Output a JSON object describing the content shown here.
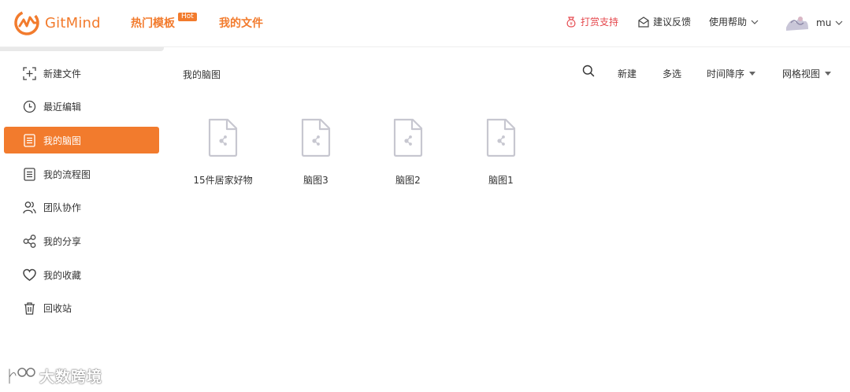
{
  "app": {
    "name": "GitMind",
    "brand_color": "#f27b2d"
  },
  "header": {
    "templates_label": "热门模板",
    "hot_badge": "Hot",
    "files_label": "我的文件",
    "reward_label": "打赏支持",
    "feedback_label": "建议反馈",
    "help_label": "使用帮助",
    "user_name": "mu"
  },
  "sidebar": {
    "items": [
      {
        "label": "新建文件",
        "icon": "new-file-icon"
      },
      {
        "label": "最近编辑",
        "icon": "clock-icon"
      },
      {
        "label": "我的脑图",
        "icon": "document-icon",
        "active": true
      },
      {
        "label": "我的流程图",
        "icon": "document-icon"
      },
      {
        "label": "团队协作",
        "icon": "team-icon"
      },
      {
        "label": "我的分享",
        "icon": "share-icon"
      },
      {
        "label": "我的收藏",
        "icon": "heart-icon"
      },
      {
        "label": "回收站",
        "icon": "trash-icon"
      }
    ]
  },
  "main": {
    "breadcrumb": "我的脑图",
    "toolbar": {
      "new_label": "新建",
      "multi_select_label": "多选",
      "sort_label": "时间降序",
      "view_label": "网格视图"
    },
    "files": [
      {
        "name": "15件居家好物"
      },
      {
        "name": "脑图3"
      },
      {
        "name": "脑图2"
      },
      {
        "name": "脑图1"
      }
    ]
  },
  "watermark": {
    "text": "大数跨境"
  }
}
